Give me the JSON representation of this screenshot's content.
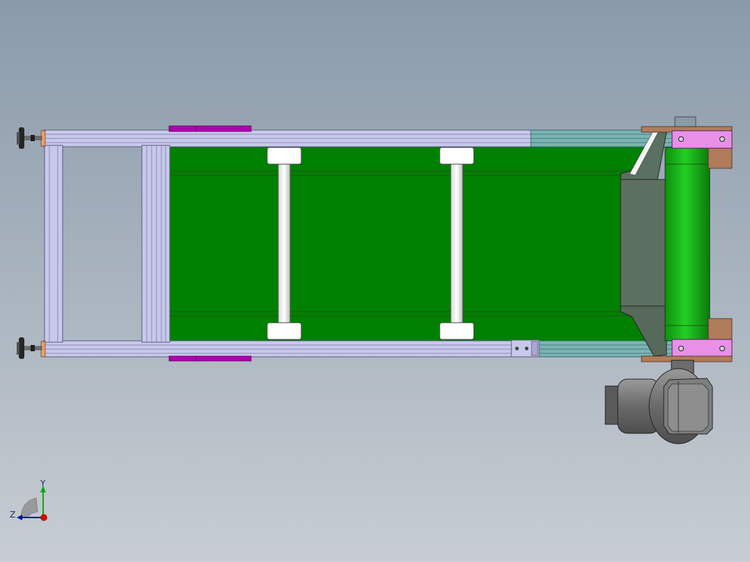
{
  "viewport": {
    "background_top": "#8a9aaa",
    "background_bottom": "#c7cdd3"
  },
  "model": {
    "belt_color": "#008000",
    "belt_line_color": "#1d5a1d",
    "frame_color": "#c8c8ec",
    "frame_edge_color": "#5a5a7a",
    "roller_color": "#ffffff",
    "bracket_magenta": "#b000b0",
    "plate_pink": "#e890e8",
    "block_brown": "#b07c5a",
    "guard_color": "#5a7060",
    "drum_color": "#14b814",
    "motor_color": "#7a7a7a",
    "teal_rail_color": "#7ab4b4"
  },
  "triad": {
    "y_label": "Y",
    "z_label": "Z",
    "y_color": "#00b000",
    "z_color": "#0000d0",
    "x_color": "#e00000"
  }
}
